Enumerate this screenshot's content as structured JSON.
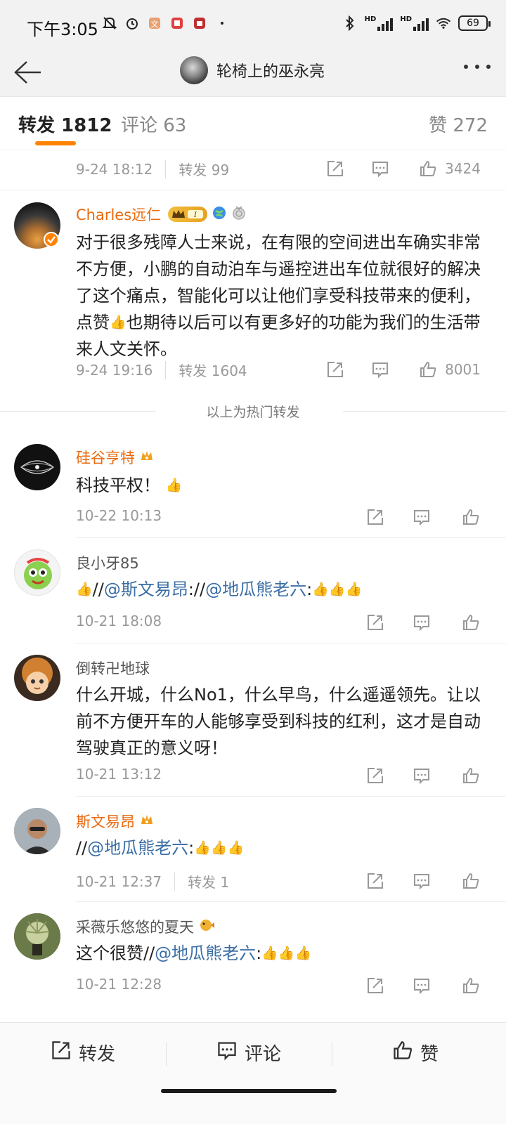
{
  "status_bar": {
    "time": "下午3:05",
    "signal_left_label": "HD",
    "signal_right_label": "HD",
    "battery": "69"
  },
  "header": {
    "title": "轮椅上的巫永亮"
  },
  "tabs": {
    "repost": "转发 1812",
    "comment": "评论 63",
    "like": "赞 272"
  },
  "top_item": {
    "date": "9-24 18:12",
    "repost_label": "转发 99",
    "like_count": "3424"
  },
  "featured": {
    "name": "Charles远仁",
    "text": "对于很多残障人士来说，在有限的空间进出车确实非常不方便，小鹏的自动泊车与遥控进出车位就很好的解决了这个痛点，智能化可以让他们享受科技带来的便利，点赞",
    "text_after": "也期待以后可以有更多好的功能为我们的生活带来人文关怀。",
    "date": "9-24 19:16",
    "repost_label": "转发 1604",
    "like_count": "8001"
  },
  "hot_label": "以上为热门转发",
  "items": [
    {
      "name": "硅谷亨特",
      "text": "科技平权！",
      "date": "10-22 10:13"
    },
    {
      "name": "良小牙85",
      "prefix": "//",
      "m1": "@斯文易昂",
      "mid": "://",
      "m2": "@地瓜熊老六",
      "suffix": ":",
      "date": "10-21 18:08"
    },
    {
      "name": "倒转卍地球",
      "text": "什么开城，什么No1，什么早鸟，什么遥遥领先。让以前不方便开车的人能够享受到科技的红利，这才是自动驾驶真正的意义呀！",
      "date": "10-21 13:12"
    },
    {
      "name": "斯文易昂",
      "prefix": "//",
      "m1": "@地瓜熊老六",
      "suffix": ":",
      "date": "10-21 12:37",
      "repost_label": "转发 1"
    },
    {
      "name": "采薇乐悠悠的夏天",
      "prefix": "这个很赞//",
      "m1": "@地瓜熊老六",
      "suffix": ":",
      "date": "10-21 12:28"
    }
  ],
  "bottom_bar": {
    "repost": "转发",
    "comment": "评论",
    "like": "赞"
  },
  "colors": {
    "accent": "#ff8200",
    "vip_name": "#e86a10",
    "mention": "#3b6ea5"
  }
}
